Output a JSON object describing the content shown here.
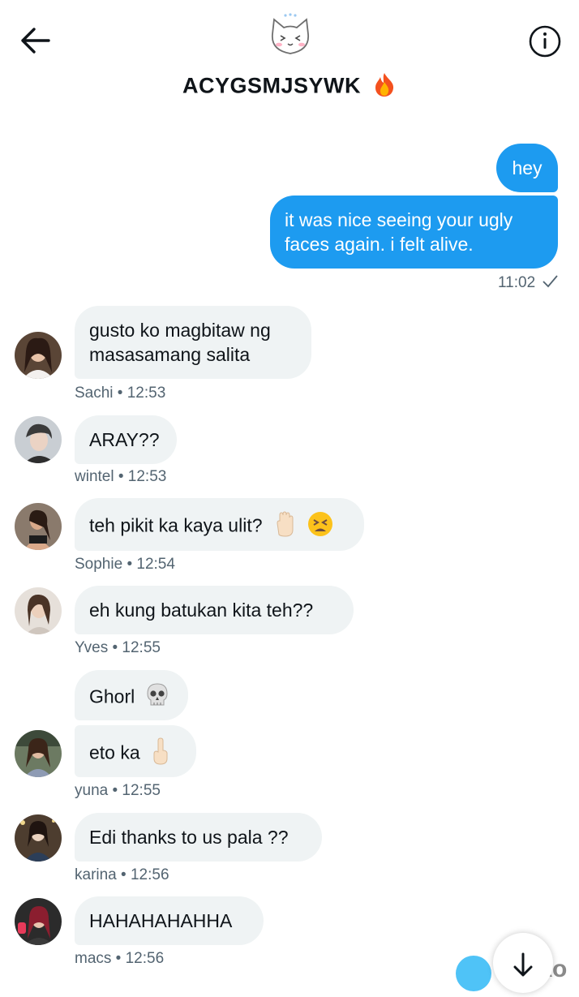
{
  "header": {
    "title": "ACYGSMJSYWK",
    "title_emoji": "fire-emoji",
    "back_icon": "arrow-left-icon",
    "info_icon": "info-icon",
    "avatar_icon": "cat-face-icon"
  },
  "outgoing": {
    "messages": [
      "hey",
      "it was nice seeing your ugly faces again. i felt alive."
    ],
    "time": "11:02",
    "status_icon": "check-icon"
  },
  "incoming": [
    {
      "text": "gusto ko magbitaw ng masasamang salita",
      "meta": "Sachi • 12:53"
    },
    {
      "text": "ARAY??",
      "meta": "wintel • 12:53"
    },
    {
      "text": "teh pikit ka kaya ulit?",
      "emoji": [
        "raised-hand-emoji",
        "tired-face-emoji"
      ],
      "meta": "Sophie • 12:54"
    },
    {
      "text": "eh kung batukan kita teh??",
      "meta": "Yves • 12:55"
    },
    {
      "text": "Ghorl",
      "emoji": [
        "skull-emoji"
      ]
    },
    {
      "text": "eto ka",
      "emoji": [
        "middle-finger-emoji"
      ],
      "meta": "yuna • 12:55"
    },
    {
      "text": "Edi thanks to us pala ??",
      "meta": "karina • 12:56"
    },
    {
      "text": "HAHAHAHAHHA",
      "meta": "macs • 12:56"
    }
  ],
  "colors": {
    "accent": "#1d9bf0",
    "incoming_bubble": "#eff3f4",
    "meta_text": "#536471"
  },
  "bottom": {
    "scroll_icon": "arrow-down-icon",
    "watermark": "iDoko"
  }
}
